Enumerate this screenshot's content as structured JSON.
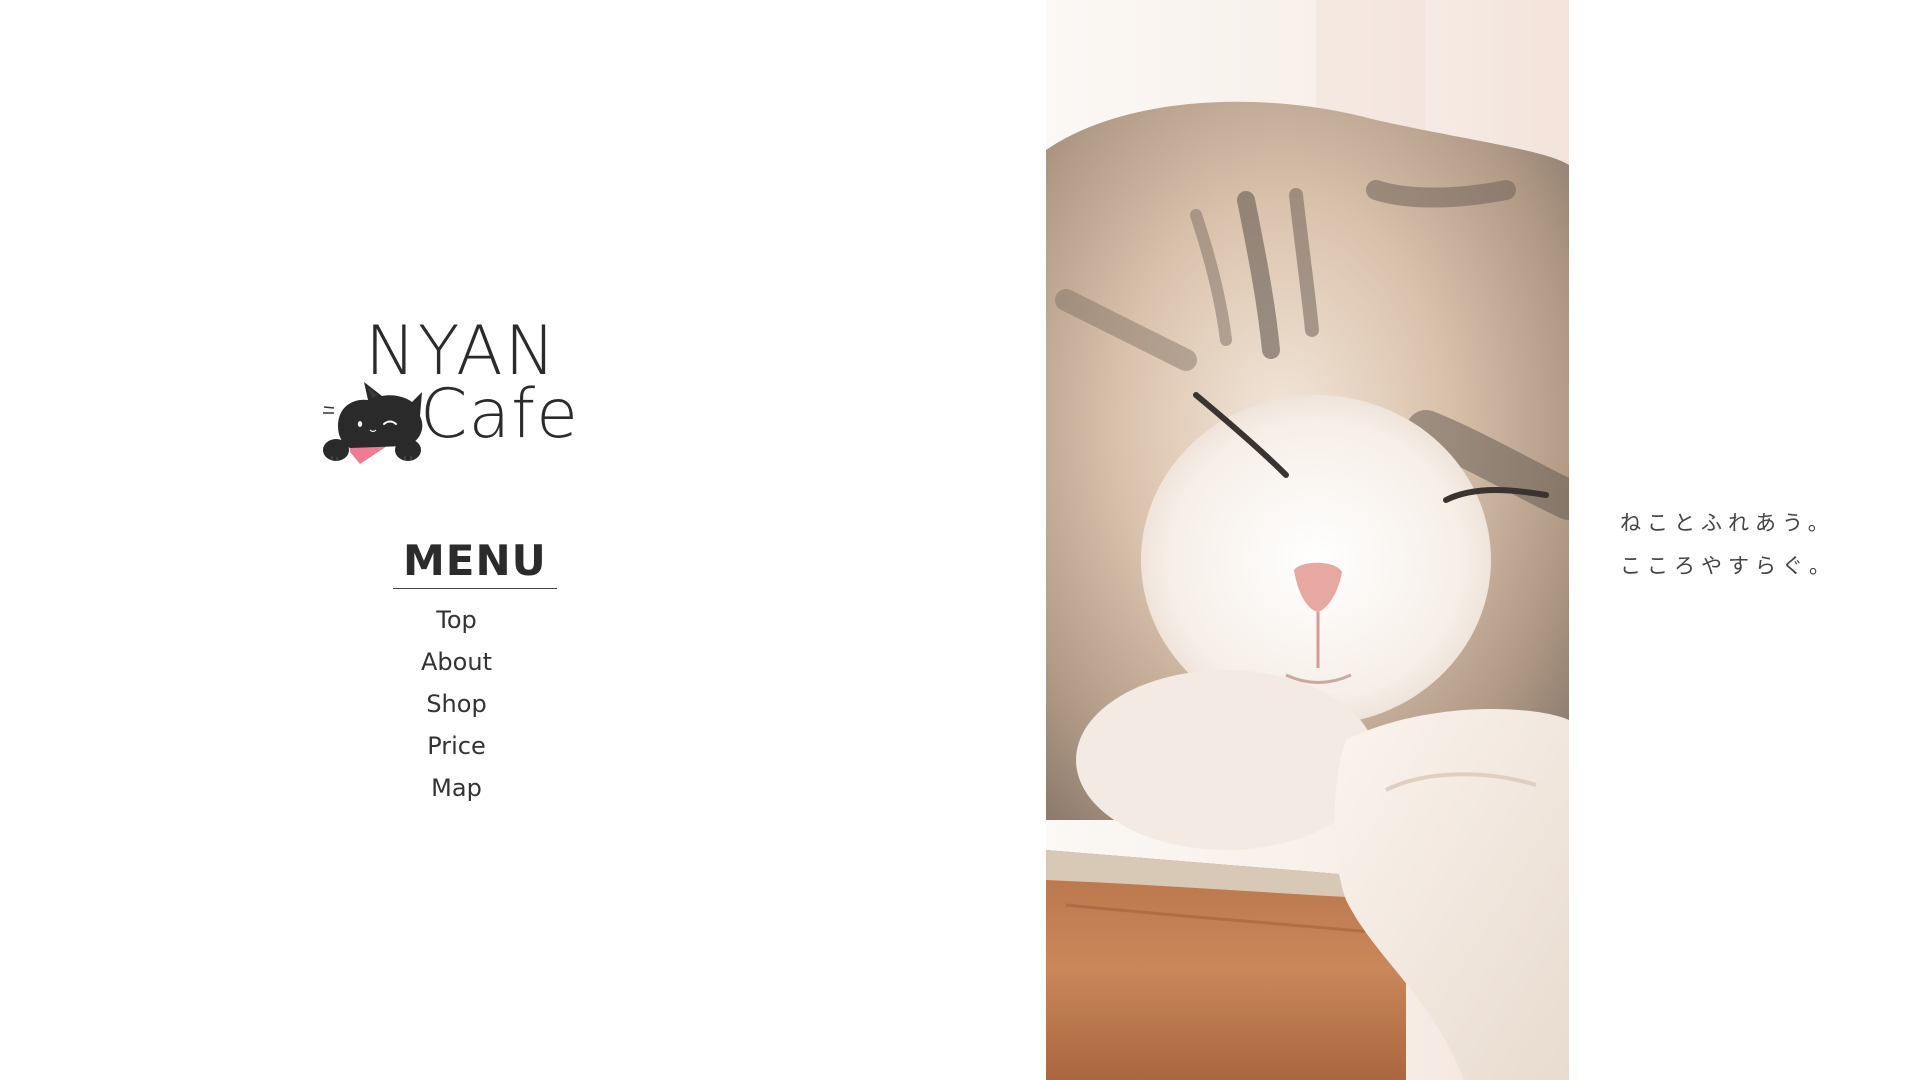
{
  "logo": {
    "line1": "NYAN",
    "line2": "Cafe",
    "mascot_icon": "black-cat-mascot-icon"
  },
  "menu": {
    "heading": "MENU",
    "items": [
      {
        "label": "Top"
      },
      {
        "label": "About"
      },
      {
        "label": "Shop"
      },
      {
        "label": "Price"
      },
      {
        "label": "Map"
      }
    ]
  },
  "hero": {
    "image": "sleeping-cat-photo"
  },
  "tagline": {
    "line1": "ねことふれあう。",
    "line2": "こころやすらぐ。"
  },
  "colors": {
    "background": "#ffffff",
    "text": "#333333",
    "accent_scarf": "#f07c93"
  }
}
